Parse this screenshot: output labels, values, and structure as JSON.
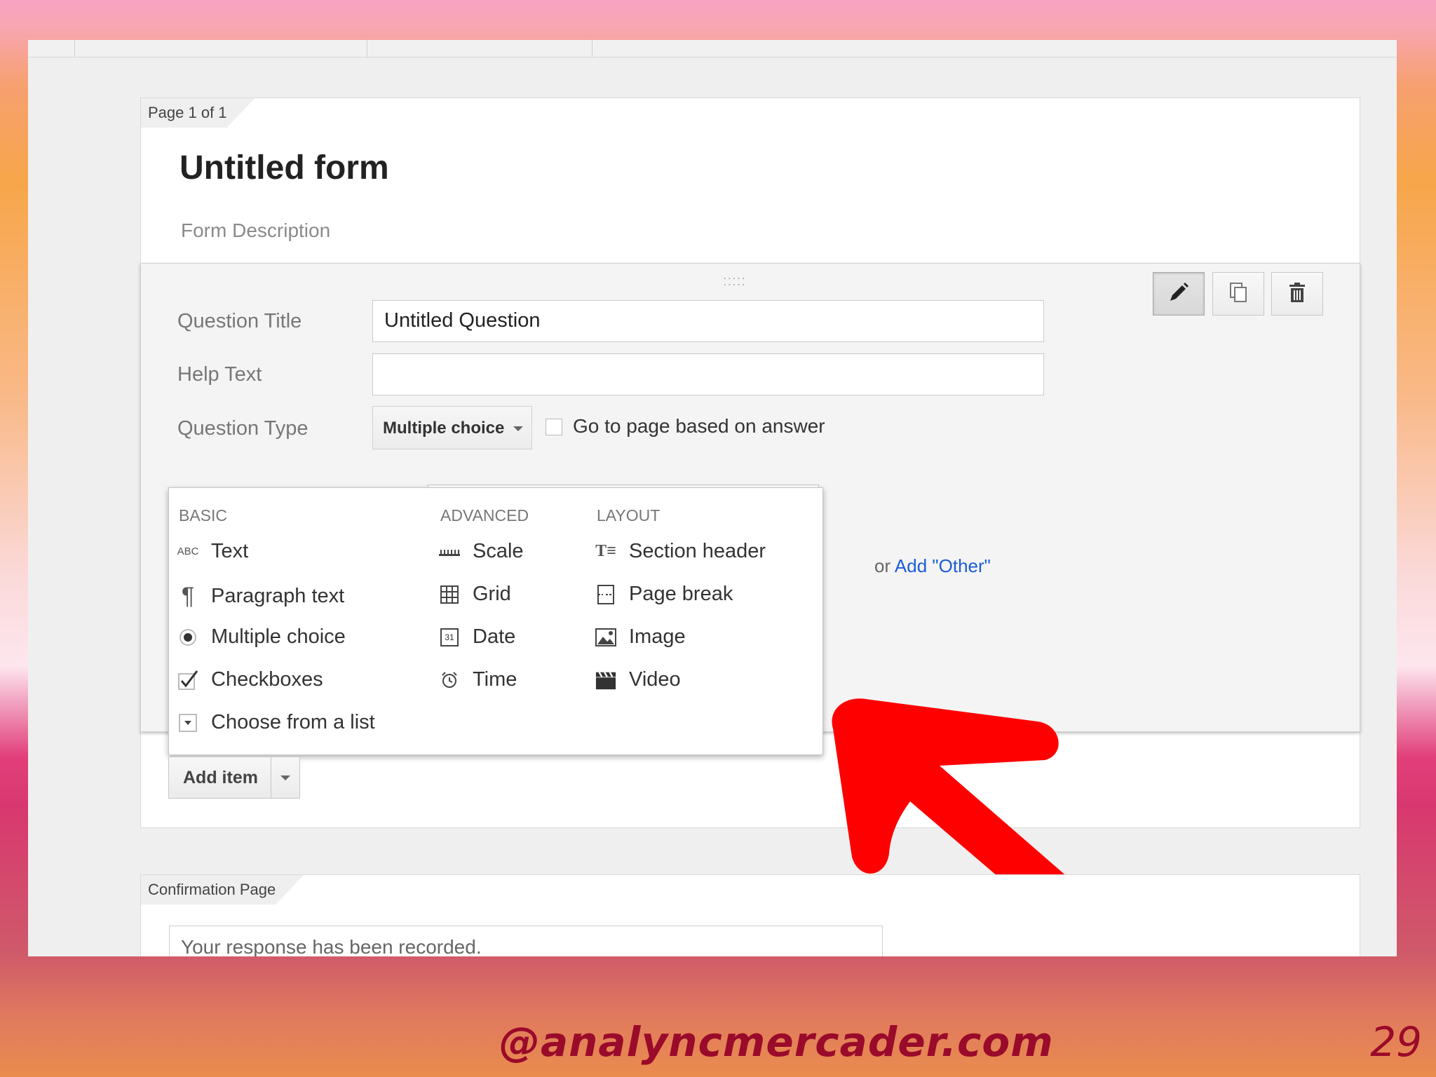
{
  "form": {
    "page_tab": "Page 1 of 1",
    "title": "Untitled form",
    "description_placeholder": "Form Description"
  },
  "question": {
    "drag_handle": ":::::",
    "title_label": "Question Title",
    "title_value": "Untitled Question",
    "help_label": "Help Text",
    "help_value": "",
    "type_label": "Question Type",
    "type_value": "Multiple choice",
    "goto_label": "Go to page based on answer",
    "add_other_prefix": "or ",
    "add_other_link": "Add \"Other\""
  },
  "menu": {
    "columns": [
      {
        "heading": "BASIC",
        "items": [
          "Text",
          "Paragraph text",
          "Multiple choice",
          "Checkboxes",
          "Choose from a list"
        ]
      },
      {
        "heading": "ADVANCED",
        "items": [
          "Scale",
          "Grid",
          "Date",
          "Time"
        ]
      },
      {
        "heading": "LAYOUT",
        "items": [
          "Section header",
          "Page break",
          "Image",
          "Video"
        ]
      }
    ],
    "icons": {
      "text": "ABC",
      "date": "31"
    }
  },
  "add_item_label": "Add item",
  "confirmation": {
    "tab": "Confirmation Page",
    "message": "Your response has been recorded."
  },
  "footer": {
    "handle": "@analyncmercader.com",
    "page_number": "29"
  },
  "colors": {
    "arrow": "#ff0000",
    "link": "#1a5dd6",
    "footer_text": "#9a0a2a"
  }
}
